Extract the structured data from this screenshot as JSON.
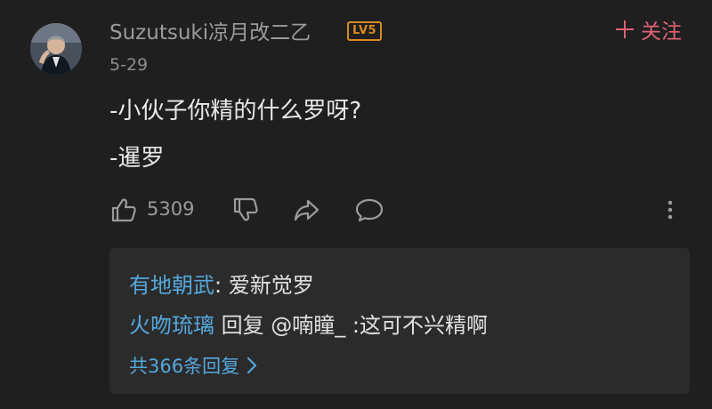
{
  "comment": {
    "username": "Suzutsuki凉月改二乙",
    "level_badge": "LV5",
    "follow_label": "关注",
    "date": "5-29",
    "lines": [
      "-小伙子你精的什么罗呀?",
      "-暹罗"
    ],
    "like_count": "5309"
  },
  "icons": {
    "follow": "plus-icon",
    "like": "thumbs-up-icon",
    "dislike": "thumbs-down-icon",
    "share": "share-arrow-icon",
    "comment": "comment-bubble-icon",
    "more": "more-vertical-icon",
    "expand": "chevron-right-icon"
  },
  "replies": {
    "items": [
      {
        "author": "有地朝武",
        "separator": ": ",
        "text": "爱新觉罗"
      },
      {
        "author": "火吻琉璃",
        "verb": " 回复 ",
        "mention": "@喃瞳_",
        "text": " :这可不兴精啊"
      }
    ],
    "view_all_label": "共366条回复"
  },
  "colors": {
    "background": "#1f1f1f",
    "reply_panel": "#2b2b2b",
    "link_blue": "#55a8de",
    "follow_pink": "#e06275",
    "badge_orange": "#d98a1f"
  }
}
